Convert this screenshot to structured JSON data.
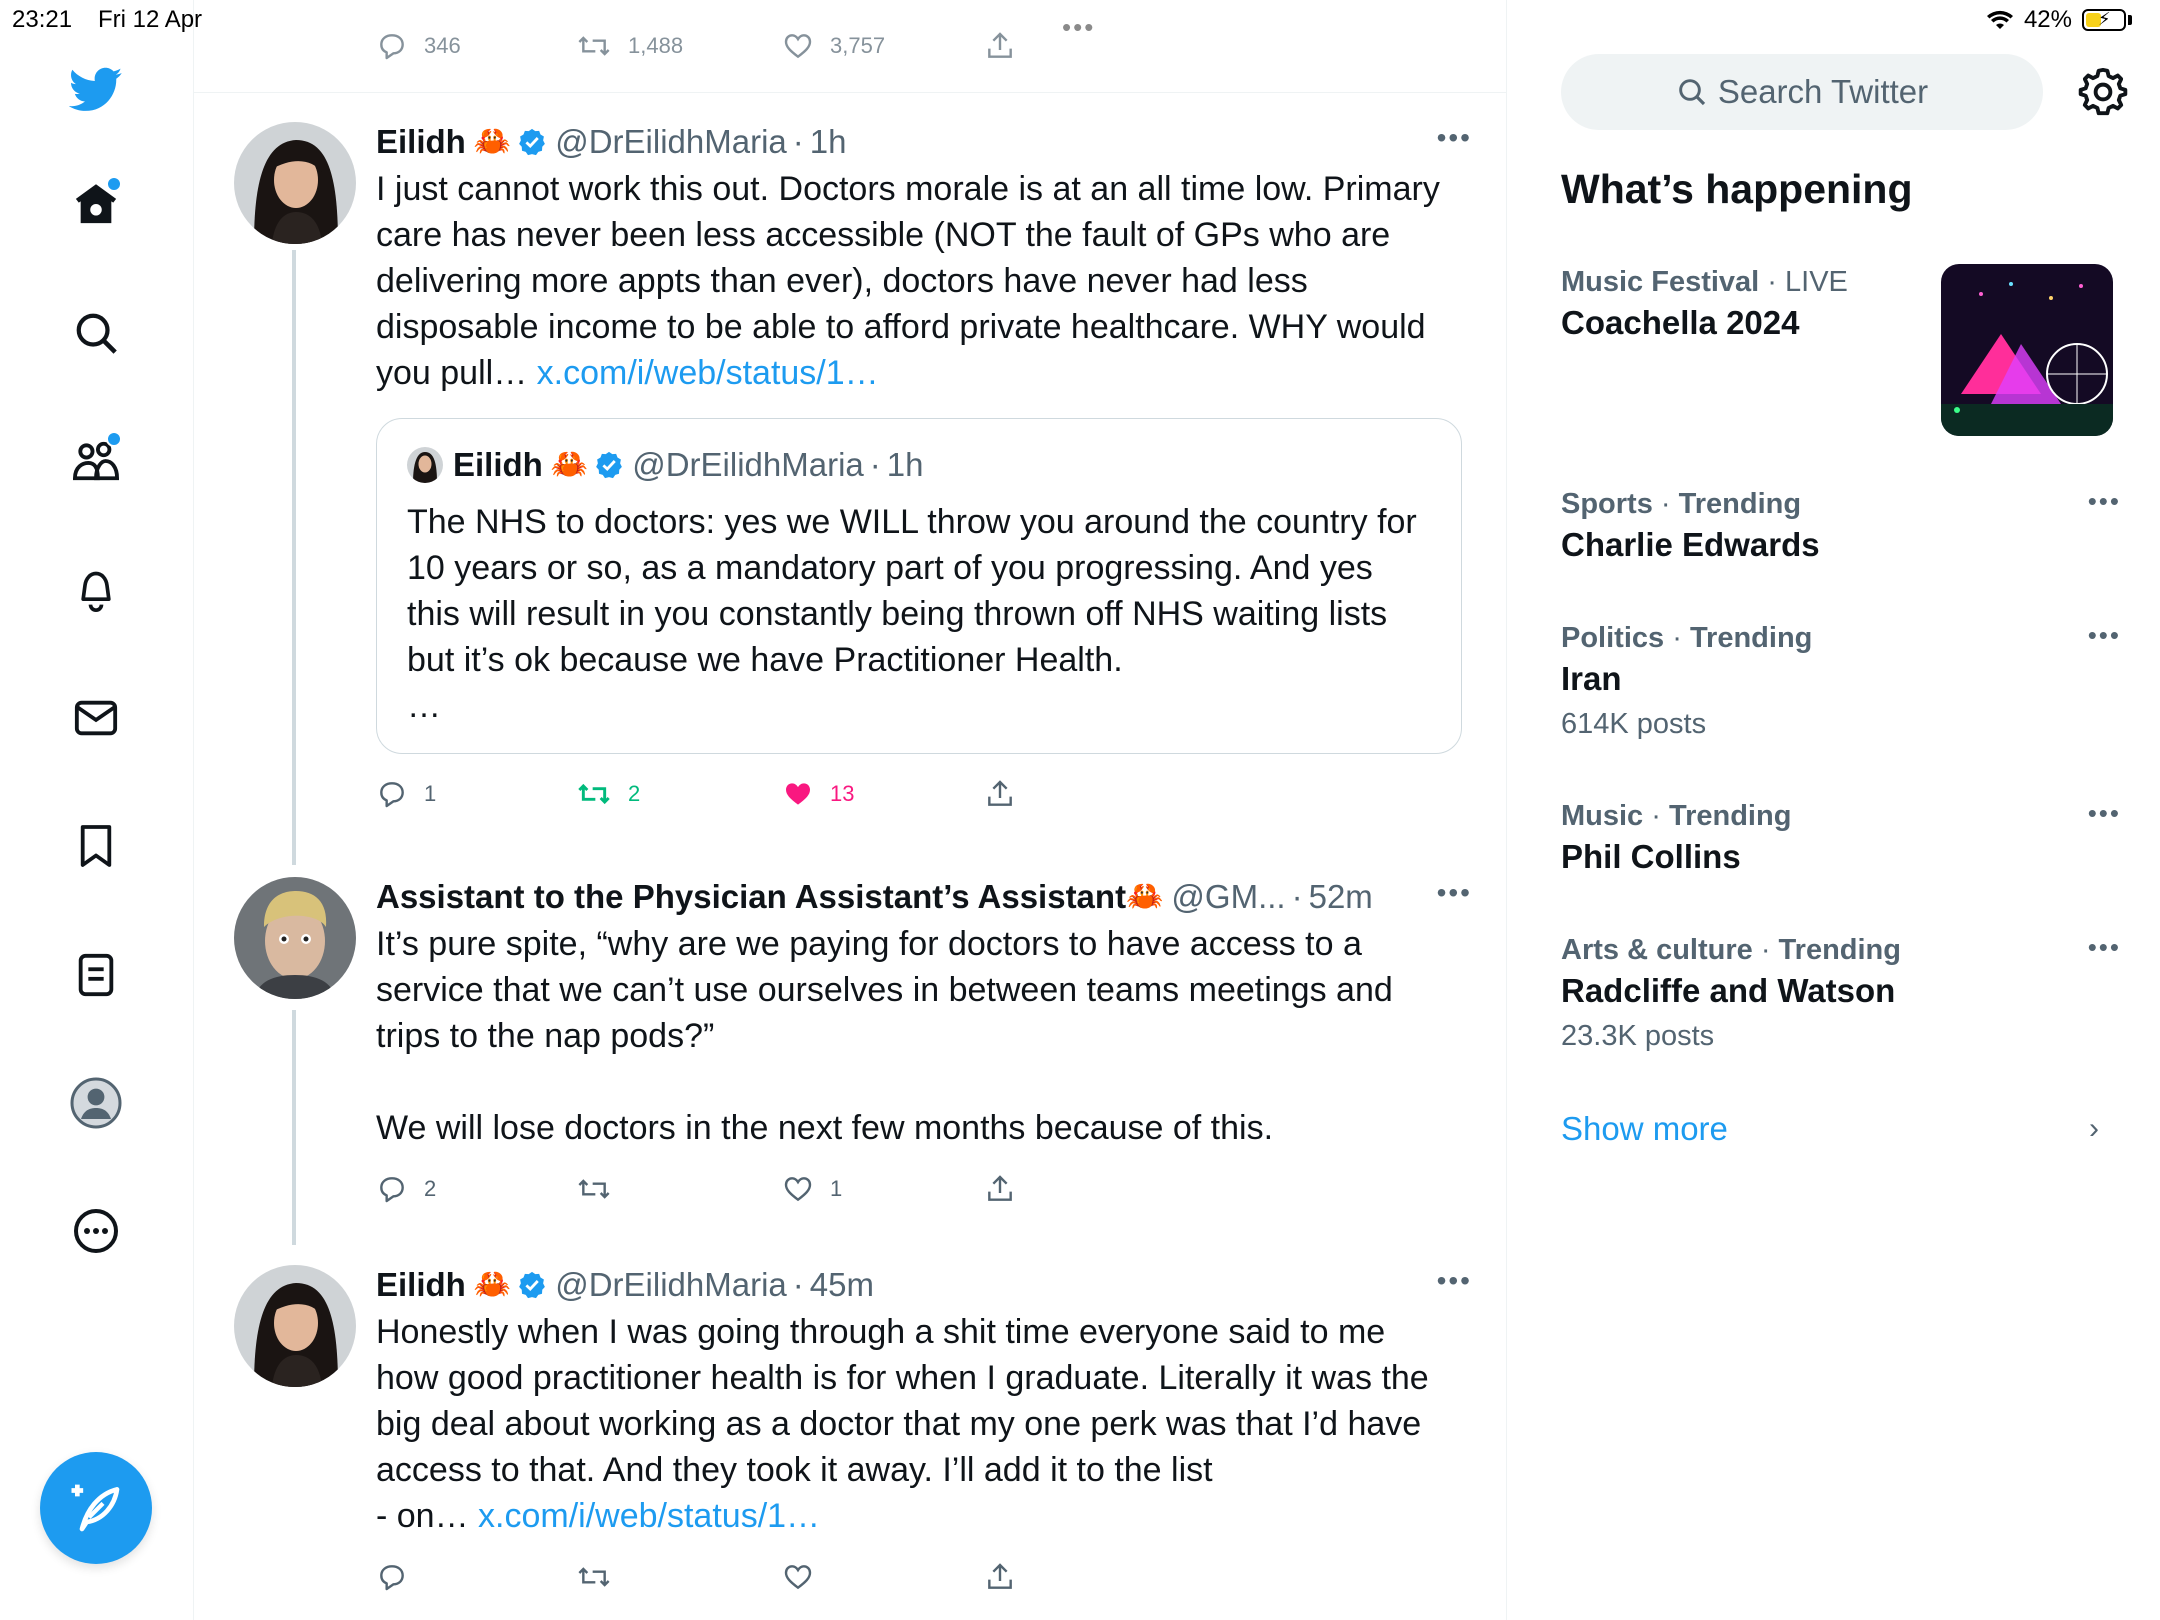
{
  "status_bar": {
    "time": "23:21",
    "date": "Fri 12 Apr",
    "battery": "42%",
    "battery_level": 0.42
  },
  "multitask": "•••",
  "nav": {
    "icons": [
      "twitter-logo-icon",
      "home-icon",
      "search-icon",
      "communities-icon",
      "notifications-icon",
      "messages-icon",
      "bookmarks-icon",
      "lists-icon",
      "profile-icon",
      "more-icon"
    ],
    "compose": "compose-icon"
  },
  "top_tweet_actions": {
    "replies": "346",
    "retweets": "1,488",
    "likes": "3,757"
  },
  "tweets": [
    {
      "name": "Eilidh",
      "emoji": "🦀",
      "handle": "@DrEilidhMaria",
      "time": "1h",
      "text": "I just cannot work this out. Doctors morale is at an all time low. Primary care has never been less accessible (NOT the fault of GPs who are delivering more appts than ever), doctors have never had less disposable income to be able to afford private healthcare. WHY would you pull… ",
      "link": "x.com/i/web/status/1…",
      "quote": {
        "name": "Eilidh",
        "emoji": "🦀",
        "handle": "@DrEilidhMaria",
        "time": "1h",
        "text": "The NHS to doctors: yes we WILL throw you around the country for 10 years or so, as a mandatory part of you progressing. And yes this will result in you constantly being thrown off NHS waiting lists but it’s ok because we have Practitioner Health.\n…"
      },
      "replies": "1",
      "retweets": "2",
      "likes": "13"
    },
    {
      "name": "Assistant to the Physician Assistant’s Assistant",
      "emoji": "🦀",
      "handle": "@GM...",
      "time": "52m",
      "text": "It’s pure spite, “why are we paying for doctors to have access to a service that we can’t use ourselves in between teams meetings and trips to the nap pods?”\n\nWe will lose doctors in the next few months because of this.",
      "replies": "2",
      "retweets": "",
      "likes": "1"
    },
    {
      "name": "Eilidh",
      "emoji": "🦀",
      "handle": "@DrEilidhMaria",
      "time": "45m",
      "text": "Honestly when I was going through a shit time everyone said to me how good practitioner health is for when I graduate. Literally it was the big deal about working as a doctor that my one perk was that I’d have access to that. And they took it away. I’ll add it to the list\n- on… ",
      "link": "x.com/i/web/status/1…",
      "replies": "",
      "retweets": "",
      "likes": ""
    }
  ],
  "right": {
    "search_placeholder": "Search Twitter",
    "title": "What’s happening",
    "trends": [
      {
        "category": "Music Festival",
        "status": "LIVE",
        "name": "Coachella 2024",
        "count": ""
      },
      {
        "category": "Sports",
        "status": "Trending",
        "name": "Charlie Edwards",
        "count": ""
      },
      {
        "category": "Politics",
        "status": "Trending",
        "name": "Iran",
        "count": "614K posts"
      },
      {
        "category": "Music",
        "status": "Trending",
        "name": "Phil Collins",
        "count": ""
      },
      {
        "category": "Arts & culture",
        "status": "Trending",
        "name": "Radcliffe and Watson",
        "count": "23.3K posts"
      }
    ],
    "show_more": "Show more"
  },
  "colors": {
    "accent": "#1d9bf0",
    "like": "#f91880",
    "retweet": "#00ba7c",
    "muted": "#536471"
  }
}
